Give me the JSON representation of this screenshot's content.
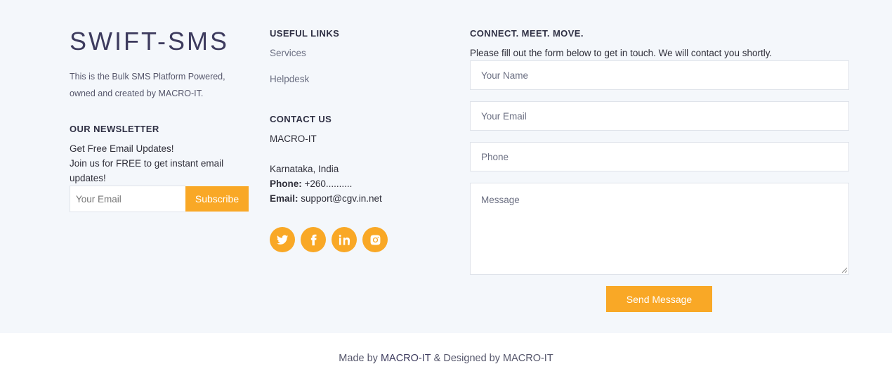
{
  "brand": {
    "title": "SWIFT-SMS",
    "about": "This is the Bulk SMS Platform Powered, owned and created by MACRO-IT."
  },
  "newsletter": {
    "title": "OUR NEWSLETTER",
    "line1": "Get Free Email Updates!",
    "line2": "Join us for FREE to get instant email updates!",
    "placeholder": "Your Email",
    "button": "Subscribe"
  },
  "useful_links": {
    "title": "USEFUL LINKS",
    "items": [
      "Services",
      "Helpdesk"
    ]
  },
  "contact": {
    "title": "CONTACT US",
    "company": "MACRO-IT",
    "location": "Karnataka, India",
    "phone_label": "Phone:",
    "phone_value": "+260..........",
    "email_label": "Email:",
    "email_value": "support@cgv.in.net"
  },
  "socials": [
    "twitter-icon",
    "facebook-icon",
    "linkedin-icon",
    "instagram-icon"
  ],
  "form": {
    "title": "CONNECT. MEET. MOVE.",
    "intro": "Please fill out the form below to get in touch. We will contact you shortly.",
    "name_placeholder": "Your Name",
    "email_placeholder": "Your Email",
    "phone_placeholder": "Phone",
    "message_placeholder": "Message",
    "submit": "Send Message"
  },
  "footer": {
    "made_by": "Made by",
    "made_by_name": "MACRO-IT",
    "designed_by": "& Designed by MACRO-IT"
  },
  "colors": {
    "accent": "#f9a826",
    "background": "#f4f7fb",
    "heading": "#2f3044"
  }
}
